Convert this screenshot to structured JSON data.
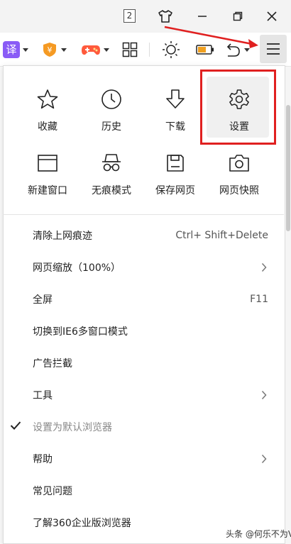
{
  "titlebar": {
    "tab_count": "2",
    "icons": [
      "skin-icon",
      "minimize-icon",
      "restore-icon",
      "close-icon"
    ]
  },
  "toolbar": {
    "translate_label": "译",
    "icons": [
      "translate-icon",
      "coupon-icon",
      "game-icon",
      "apps-grid-icon",
      "brightness-icon",
      "battery-icon",
      "undo-icon",
      "menu-icon"
    ],
    "colors": {
      "translate": "#8a5cf6",
      "coupon": "#f59a23",
      "game": "#ff5a3c",
      "battery": "#f0a020"
    }
  },
  "menu": {
    "grid": [
      {
        "label": "收藏",
        "icon": "star-icon"
      },
      {
        "label": "历史",
        "icon": "clock-icon"
      },
      {
        "label": "下载",
        "icon": "download-icon"
      },
      {
        "label": "设置",
        "icon": "gear-icon"
      },
      {
        "label": "新建窗口",
        "icon": "new-window-icon"
      },
      {
        "label": "无痕模式",
        "icon": "incognito-icon"
      },
      {
        "label": "保存网页",
        "icon": "save-icon"
      },
      {
        "label": "网页快照",
        "icon": "camera-icon"
      }
    ],
    "items": [
      {
        "label": "清除上网痕迹",
        "shortcut": "Ctrl+ Shift+Delete"
      },
      {
        "label": "网页缩放（100%）",
        "submenu": true
      },
      {
        "label": "全屏",
        "shortcut": "F11"
      },
      {
        "label": "切换到IE6多窗口模式"
      },
      {
        "label": "广告拦截"
      },
      {
        "label": "工具",
        "submenu": true
      },
      {
        "label": "设置为默认浏览器",
        "checked": true,
        "dimmed": true
      },
      {
        "label": "帮助",
        "submenu": true
      },
      {
        "label": "常见问题"
      },
      {
        "label": "了解360企业版浏览器"
      }
    ]
  },
  "annotation": {
    "color": "#e02020"
  },
  "watermark": "头条 @何乐不为V"
}
